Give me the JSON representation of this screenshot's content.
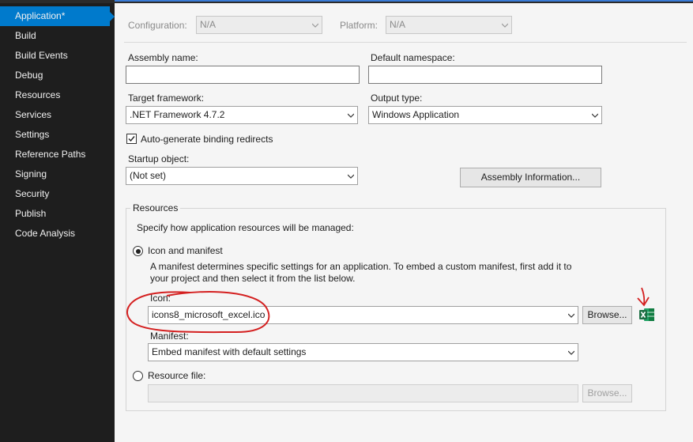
{
  "sidebar": {
    "items": [
      {
        "label": "Application*"
      },
      {
        "label": "Build"
      },
      {
        "label": "Build Events"
      },
      {
        "label": "Debug"
      },
      {
        "label": "Resources"
      },
      {
        "label": "Services"
      },
      {
        "label": "Settings"
      },
      {
        "label": "Reference Paths"
      },
      {
        "label": "Signing"
      },
      {
        "label": "Security"
      },
      {
        "label": "Publish"
      },
      {
        "label": "Code Analysis"
      }
    ],
    "selected": "Application*"
  },
  "toolbar": {
    "configuration_label": "Configuration:",
    "configuration_value": "N/A",
    "platform_label": "Platform:",
    "platform_value": "N/A"
  },
  "form": {
    "assembly_name_label": "Assembly name:",
    "assembly_name_value": "",
    "default_namespace_label": "Default namespace:",
    "default_namespace_value": "",
    "target_framework_label": "Target framework:",
    "target_framework_value": ".NET Framework 4.7.2",
    "output_type_label": "Output type:",
    "output_type_value": "Windows Application",
    "auto_binding_label": "Auto-generate binding redirects",
    "auto_binding_checked": true,
    "startup_object_label": "Startup object:",
    "startup_object_value": "(Not set)",
    "assembly_info_button": "Assembly Information..."
  },
  "resources": {
    "group_label": "Resources",
    "description": "Specify how application resources will be managed:",
    "icon_manifest_label": "Icon and manifest",
    "icon_manifest_selected": true,
    "manifest_help_line1": "A manifest determines specific settings for an application. To embed a custom manifest, first add it to",
    "manifest_help_line2": "your project and then select it from the list below.",
    "icon_label": "Icon:",
    "icon_value": "icons8_microsoft_excel.ico",
    "browse_label": "Browse...",
    "manifest_label": "Manifest:",
    "manifest_value": "Embed manifest with default settings",
    "resource_file_label": "Resource file:",
    "resource_file_value": "",
    "resource_browse_label": "Browse..."
  },
  "colors": {
    "sidebar_bg": "#1e1e1e",
    "selected_item": "#007acc",
    "annotation": "#d42020",
    "excel_green": "#1d7044"
  }
}
